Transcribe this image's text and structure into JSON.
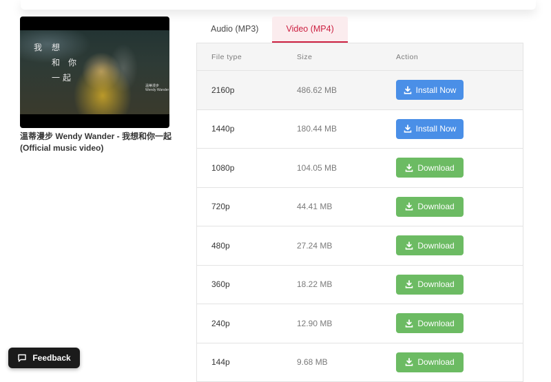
{
  "video": {
    "title": "溫蒂漫步 Wendy Wander - 我想和你一起 (Official music video)",
    "thumbnail_chars": [
      "我",
      "想",
      "和",
      "你",
      "一",
      "起"
    ],
    "thumbnail_credit": "溫蒂漫步 Wendy Wander"
  },
  "tabs": [
    {
      "label": "Audio (MP3)",
      "active": false
    },
    {
      "label": "Video (MP4)",
      "active": true
    }
  ],
  "table": {
    "headers": {
      "file_type": "File type",
      "size": "Size",
      "action": "Action"
    },
    "rows": [
      {
        "type": "2160p",
        "size": "486.62 MB",
        "action": "Install Now",
        "button_style": "install",
        "icon": "download-icon"
      },
      {
        "type": "1440p",
        "size": "180.44 MB",
        "action": "Install Now",
        "button_style": "install",
        "icon": "download-icon"
      },
      {
        "type": "1080p",
        "size": "104.05 MB",
        "action": "Download",
        "button_style": "download",
        "icon": "download-icon"
      },
      {
        "type": "720p",
        "size": "44.41 MB",
        "action": "Download",
        "button_style": "download",
        "icon": "download-icon"
      },
      {
        "type": "480p",
        "size": "27.24 MB",
        "action": "Download",
        "button_style": "download",
        "icon": "download-icon"
      },
      {
        "type": "360p",
        "size": "18.22 MB",
        "action": "Download",
        "button_style": "download",
        "icon": "download-icon"
      },
      {
        "type": "240p",
        "size": "12.90 MB",
        "action": "Download",
        "button_style": "download",
        "icon": "download-icon"
      },
      {
        "type": "144p",
        "size": "9.68 MB",
        "action": "Download",
        "button_style": "download",
        "icon": "download-icon"
      }
    ]
  },
  "feedback": {
    "label": "Feedback",
    "icon": "chat-bubble-icon"
  },
  "colors": {
    "install_button": "#4a8fe7",
    "download_button": "#6cbb63",
    "active_tab": "#cc1f40",
    "active_tab_bg": "#fbecee",
    "feedback_bg": "#1b1b1b"
  }
}
